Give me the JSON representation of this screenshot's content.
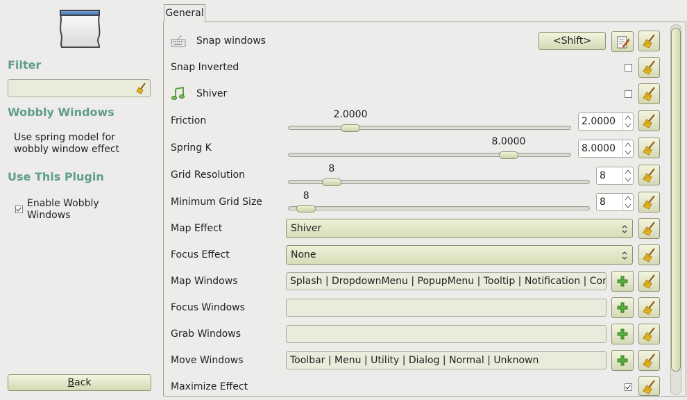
{
  "sidebar": {
    "filter_heading": "Filter",
    "filter_value": "",
    "plugin_name": "Wobbly Windows",
    "plugin_description": "Use spring model for wobbly window effect",
    "use_heading": "Use This Plugin",
    "enable_label": "Enable Wobbly Windows",
    "enable_checked": true,
    "back_label": "Back",
    "back_underlined_char": "B",
    "back_rest": "ack"
  },
  "tabs": {
    "general": "General"
  },
  "settings": {
    "snap_windows": {
      "label": "Snap windows",
      "key_binding": "<Shift>"
    },
    "snap_inverted": {
      "label": "Snap Inverted",
      "checked": false
    },
    "shiver": {
      "label": "Shiver",
      "checked": false
    },
    "friction": {
      "label": "Friction",
      "value": "2.0000",
      "slider_value": "2.0000",
      "fraction": 0.2
    },
    "spring_k": {
      "label": "Spring K",
      "value": "8.0000",
      "slider_value": "8.0000",
      "fraction": 0.8
    },
    "grid_resolution": {
      "label": "Grid Resolution",
      "value": "8",
      "slider_value": "8",
      "fraction": 0.12
    },
    "min_grid_size": {
      "label": "Minimum Grid Size",
      "value": "8",
      "slider_value": "8",
      "fraction": 0.03
    },
    "map_effect": {
      "label": "Map Effect",
      "value": "Shiver"
    },
    "focus_effect": {
      "label": "Focus Effect",
      "value": "None"
    },
    "map_windows": {
      "label": "Map Windows",
      "value": "Splash | DropdownMenu | PopupMenu | Tooltip | Notification | Combo | Dnd | Unknown"
    },
    "focus_windows": {
      "label": "Focus Windows",
      "value": ""
    },
    "grab_windows": {
      "label": "Grab Windows",
      "value": ""
    },
    "move_windows": {
      "label": "Move Windows",
      "value": "Toolbar | Menu | Utility | Dialog | Normal | Unknown"
    },
    "maximize_effect": {
      "label": "Maximize Effect",
      "checked": true
    }
  },
  "colors": {
    "heading": "#5e9e8a",
    "button_top": "#f3f5df",
    "button_bottom": "#d4d9b4"
  },
  "icons": {
    "reset": "broom-icon",
    "edit": "edit-icon",
    "add": "plus-icon",
    "keyboard": "keyboard-icon",
    "music": "music-note-icon"
  }
}
